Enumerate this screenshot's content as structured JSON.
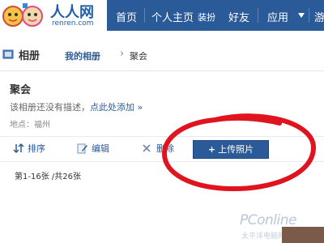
{
  "nav": {
    "logo_text": "人人网",
    "logo_url": "renren.com",
    "items": [
      {
        "label": "首页"
      },
      {
        "label": "个人主页"
      },
      {
        "label": "装扮"
      },
      {
        "label": "好友"
      },
      {
        "label": "应用"
      },
      {
        "label": "游"
      }
    ]
  },
  "header": {
    "title": "相册",
    "breadcrumb_my": "我的相册",
    "breadcrumb_sep": "›",
    "breadcrumb_current": "聚会"
  },
  "album": {
    "name": "聚会",
    "desc_text": "该相册还没有描述，",
    "desc_link": "点此处添加",
    "desc_arrow": "»",
    "location": "地点：福州"
  },
  "toolbar": {
    "sort": "排序",
    "edit": "编辑",
    "delete": "删除",
    "upload_plus": "+",
    "upload": "上传照片"
  },
  "count": "第1-16张 /共26张",
  "watermark": {
    "logo": "PConline",
    "sub": "太平洋电脑网"
  },
  "colors": {
    "nav_bg": "#2a5b98",
    "link": "#2a5b98",
    "annotation": "#e0141e"
  }
}
